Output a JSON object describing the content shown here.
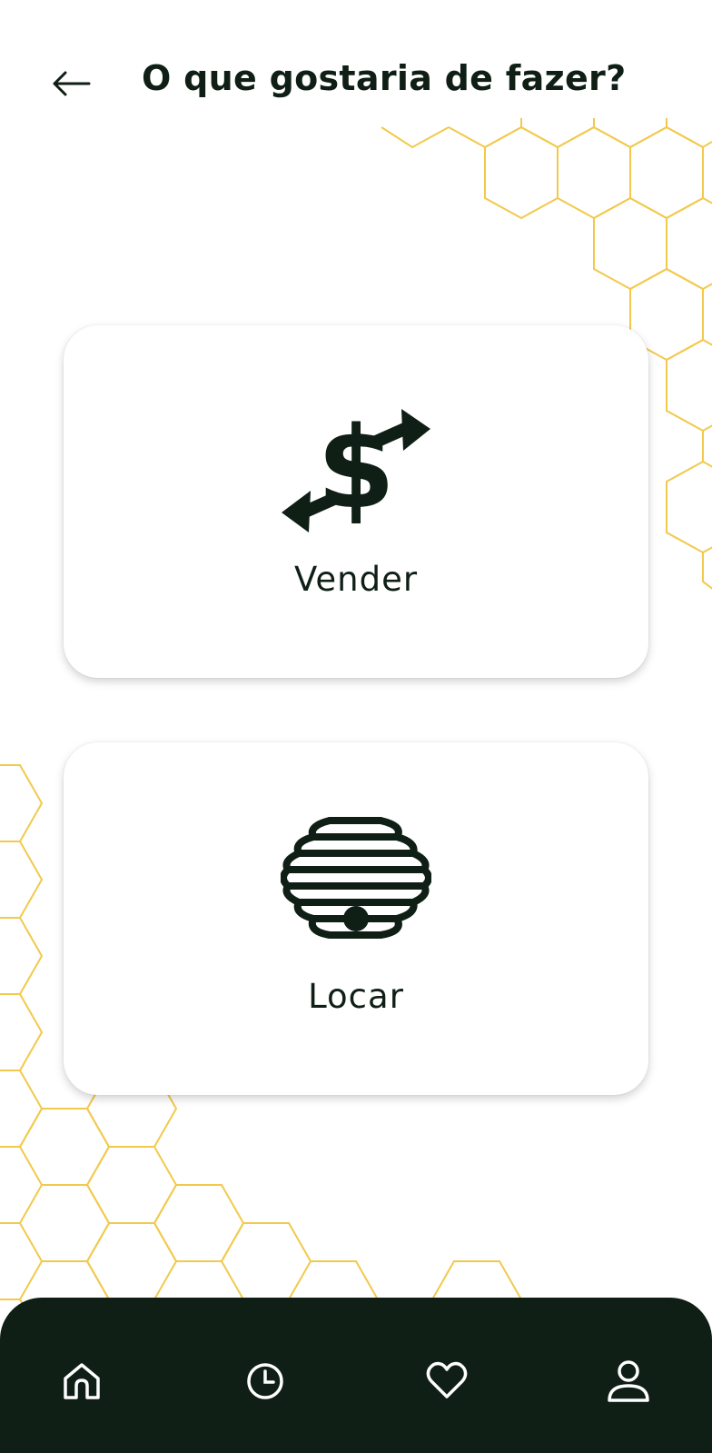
{
  "header": {
    "title": "O que gostaria de fazer?",
    "back_icon": "arrow-left-icon"
  },
  "options": [
    {
      "label": "Vender",
      "icon": "dollar-exchange-icon"
    },
    {
      "label": "Locar",
      "icon": "beehive-icon"
    }
  ],
  "bottom_nav": {
    "items": [
      {
        "icon": "home-icon"
      },
      {
        "icon": "clock-icon"
      },
      {
        "icon": "heart-icon"
      },
      {
        "icon": "user-icon"
      }
    ]
  },
  "colors": {
    "primary_dark": "#0f1f16",
    "honeycomb": "#f2c94c",
    "background": "#ffffff"
  }
}
